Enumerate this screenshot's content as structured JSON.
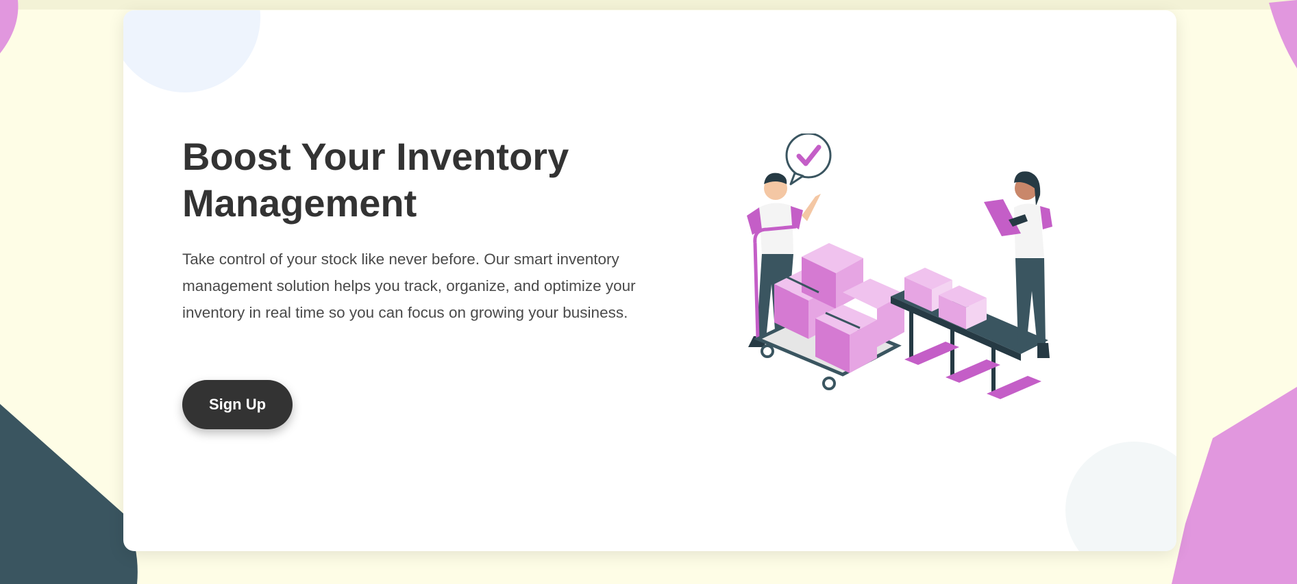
{
  "hero": {
    "title": "Boost Your Inventory Management",
    "description": "Take control of your stock like never before. Our smart inventory management solution helps you track, organize, and optimize your inventory in real time so you can focus on growing your business.",
    "cta_label": "Sign Up"
  },
  "colors": {
    "page_background": "#fefde6",
    "card_background": "#ffffff",
    "text_dark": "#333333",
    "accent_pink": "#e197de",
    "accent_magenta": "#c45ec7",
    "slate": "#3a5560"
  },
  "illustration": {
    "icons": [
      "check-bubble-icon",
      "worker-with-cart",
      "worker-with-scanner",
      "conveyor-belt",
      "stacked-boxes"
    ]
  }
}
